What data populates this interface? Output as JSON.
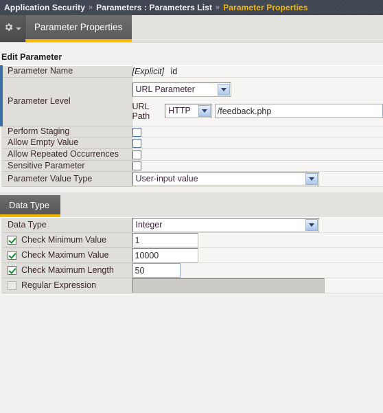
{
  "breadcrumb": {
    "separator": "»",
    "items": [
      {
        "label": "Application Security",
        "current": false
      },
      {
        "label": "Parameters : Parameters List",
        "current": false
      },
      {
        "label": "Parameter Properties",
        "current": true
      }
    ]
  },
  "toolbar": {
    "gear_icon": "gear-icon",
    "caret_icon": "chevron-down-icon",
    "active_tab": "Parameter Properties"
  },
  "edit_section": {
    "heading": "Edit Parameter",
    "rows": {
      "parameter_name": {
        "label": "Parameter Name",
        "explicit_tag": "[Explicit]",
        "value": "id"
      },
      "parameter_level": {
        "label": "Parameter Level",
        "level_select": "URL Parameter",
        "url_path_label": "URL Path",
        "protocol_select": "HTTP",
        "url_path_value": "/feedback.php"
      },
      "perform_staging": {
        "label": "Perform Staging",
        "checked": false
      },
      "allow_empty_value": {
        "label": "Allow Empty Value",
        "checked": false
      },
      "allow_repeated_occurrences": {
        "label": "Allow Repeated Occurrences",
        "checked": false
      },
      "sensitive_parameter": {
        "label": "Sensitive Parameter",
        "checked": false
      },
      "parameter_value_type": {
        "label": "Parameter Value Type",
        "value": "User-input value"
      }
    }
  },
  "data_type_section": {
    "tab_label": "Data Type",
    "rows": {
      "data_type": {
        "label": "Data Type",
        "value": "Integer"
      },
      "check_minimum_value": {
        "label": "Check Minimum Value",
        "value": "1",
        "checked": true
      },
      "check_maximum_value": {
        "label": "Check Maximum Value",
        "value": "10000",
        "checked": true
      },
      "check_maximum_length": {
        "label": "Check Maximum Length",
        "value": "50",
        "checked": true
      },
      "regular_expression": {
        "label": "Regular Expression",
        "value": "",
        "checked": false
      }
    }
  },
  "colors": {
    "breadcrumb_bg": "#3f4652",
    "breadcrumb_current": "#f5b800",
    "tab_underline": "#f5b800",
    "required_marker": "#3b6ea5",
    "label_bg": "#e0dedb",
    "value_bg": "#f6f5f3",
    "check_green": "#158a2b"
  }
}
